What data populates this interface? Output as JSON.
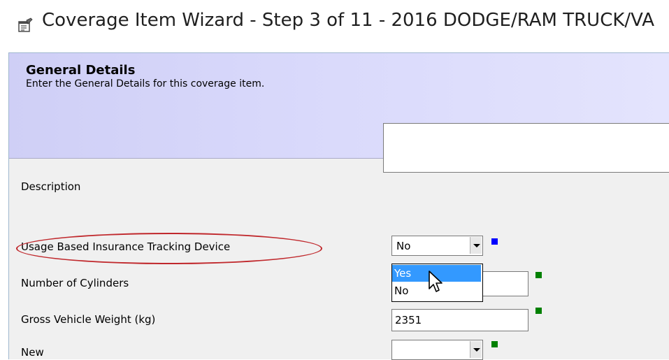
{
  "window": {
    "title": "Coverage Item Wizard - Step 3 of 11 - 2016 DODGE/RAM TRUCK/VA"
  },
  "header": {
    "title": "General Details",
    "subtitle": "Enter the General Details for this coverage item."
  },
  "fields": {
    "description": {
      "label": "Description",
      "value": ""
    },
    "ubi_tracking": {
      "label": "Usage Based Insurance Tracking Device",
      "value": "No",
      "indicator_color": "#0000ff"
    },
    "cylinders": {
      "label": "Number of Cylinders",
      "value": "",
      "indicator_color": "#008000"
    },
    "gvw": {
      "label": "Gross Vehicle Weight (kg)",
      "value": "2351",
      "indicator_color": "#008000"
    },
    "new": {
      "label": "New",
      "value": "",
      "indicator_color": "#008000"
    }
  },
  "dropdown": {
    "options": [
      "Yes",
      "No"
    ],
    "highlighted": "Yes"
  },
  "colors": {
    "highlight_ellipse": "#c0282c",
    "selection": "#3399ff",
    "header_gradient_start": "#cfcff6"
  },
  "icons": {
    "title_icon": "properties-icon",
    "cursor": "arrow-cursor-icon"
  }
}
